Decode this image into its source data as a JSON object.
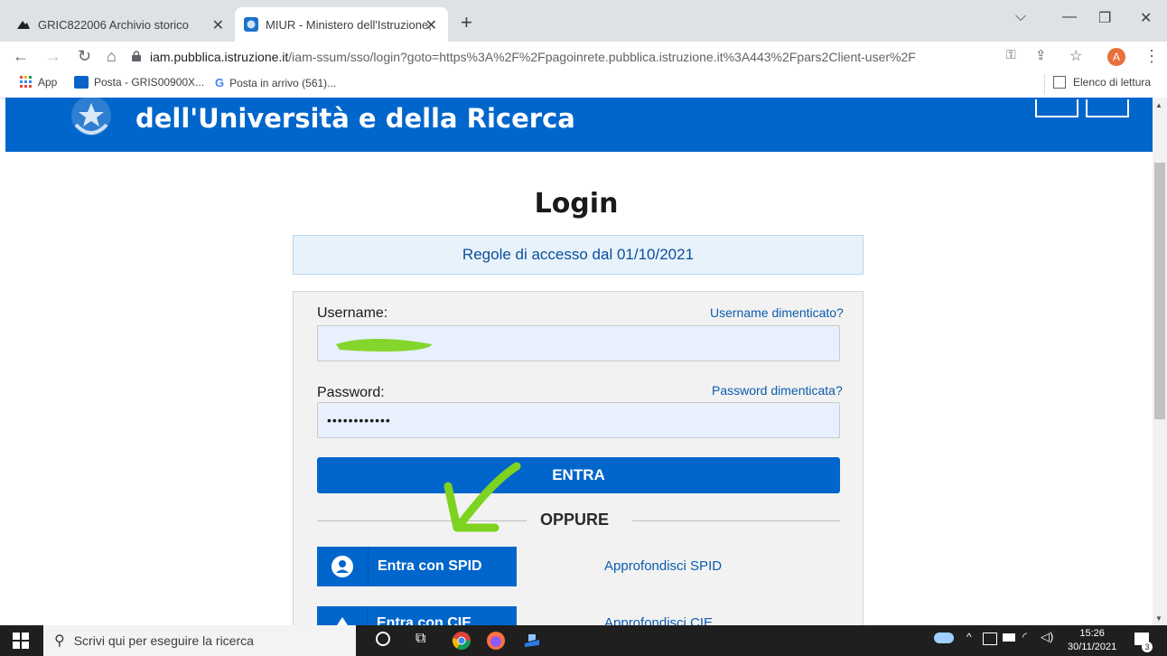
{
  "browser": {
    "tabs": [
      {
        "label": "GRIC822006 Archivio storico"
      },
      {
        "label": "MIUR - Ministero dell'Istruzione,"
      }
    ],
    "url_host": "iam.pubblica.istruzione.it",
    "url_rest": "/iam-ssum/sso/login?goto=https%3A%2F%2Fpagoinrete.pubblica.istruzione.it%3A443%2Fpars2Client-user%2F",
    "profile_initial": "A",
    "bookmarks": [
      {
        "label": "App"
      },
      {
        "label": "Posta - GRIS00900X..."
      },
      {
        "label": "Posta in arrivo (561)..."
      }
    ],
    "reading_list": "Elenco di lettura"
  },
  "page": {
    "header_title": "dell'Università e della Ricerca",
    "login_title": "Login",
    "rules_link": "Regole di accesso dal 01/10/2021",
    "username_label": "Username:",
    "username_forgot": "Username dimenticato?",
    "password_label": "Password:",
    "password_forgot": "Password dimenticata?",
    "password_value": "••••••••••••",
    "enter_button": "ENTRA",
    "or_label": "OPPURE",
    "spid_button": "Entra con SPID",
    "spid_more": "Approfondisci SPID",
    "cie_button": "Entra con CIE",
    "cie_more": "Approfondisci CIE"
  },
  "taskbar": {
    "search_placeholder": "Scrivi qui per eseguire la ricerca",
    "time": "15:26",
    "date": "30/11/2021",
    "notifications": "3"
  },
  "colors": {
    "brand_blue": "#0066cc",
    "highlighter": "#7ed321"
  }
}
